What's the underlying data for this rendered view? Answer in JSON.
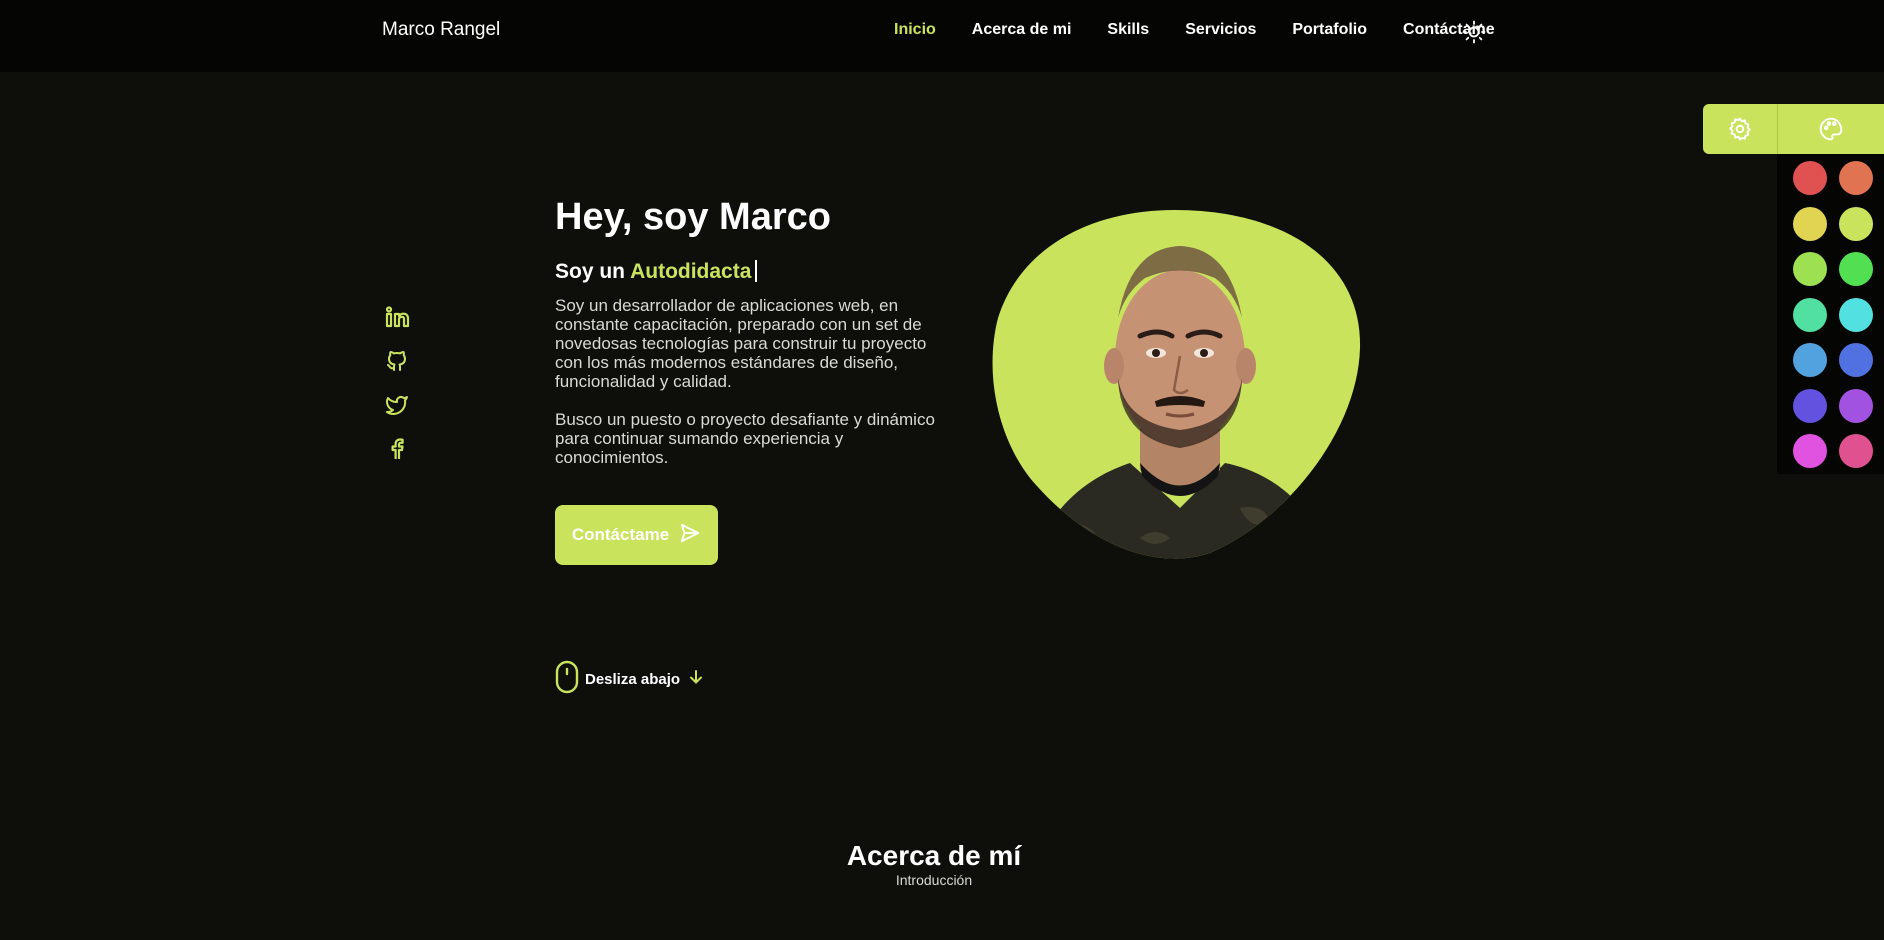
{
  "brand": "Marco Rangel",
  "nav": {
    "items": [
      {
        "label": "Inicio",
        "active": true
      },
      {
        "label": "Acerca de mi",
        "active": false
      },
      {
        "label": "Skills",
        "active": false
      },
      {
        "label": "Servicios",
        "active": false
      },
      {
        "label": "Portafolio",
        "active": false
      },
      {
        "label": "Contáctame",
        "active": false
      }
    ],
    "theme_icon": "sun-icon"
  },
  "social": [
    "linkedin-icon",
    "github-icon",
    "twitter-icon",
    "facebook-icon"
  ],
  "hero": {
    "title": "Hey, soy Marco",
    "subtitle_prefix": "Soy un",
    "role": "Autodidacta",
    "paragraph1": "Soy un desarrollador de aplicaciones web, en constante capacitación, preparado con un set de novedosas tecnologías para construir tu proyecto con los más modernos estándares de diseño, funcionalidad y calidad.",
    "paragraph2": "Busco un puesto o proyecto desafiante y dinámico para continuar sumando experiencia y conocimientos.",
    "cta_label": "Contáctame",
    "cta_icon": "send-icon"
  },
  "scroll": {
    "label": "Desliza abajo",
    "icons": [
      "mouse-icon",
      "arrow-down-icon"
    ]
  },
  "about": {
    "title": "Acerca de mí",
    "subtitle": "Introducción"
  },
  "theme_panel": {
    "tabs": [
      "gear-icon",
      "palette-icon"
    ],
    "swatches": [
      "#e05252",
      "#e07352",
      "#e0d452",
      "#c9e45c",
      "#9de052",
      "#52e052",
      "#52e0a2",
      "#52e0e0",
      "#52a2e0",
      "#5271e0",
      "#6352e0",
      "#a252e0",
      "#e052e0",
      "#e0528f"
    ]
  },
  "colors": {
    "accent": "#c9e45c",
    "background": "#0e0f0b",
    "navbar": "#050604"
  }
}
